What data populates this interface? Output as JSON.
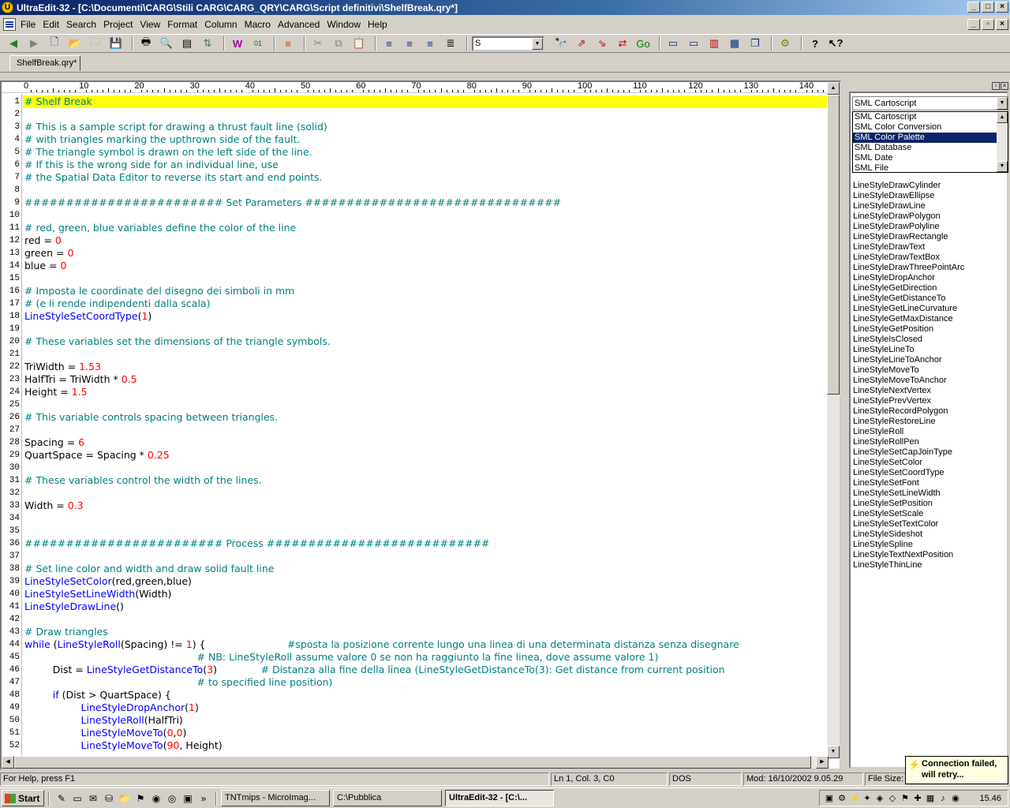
{
  "window": {
    "title": "UltraEdit-32 - [C:\\Documenti\\CARG\\Stili CARG\\CARG_QRY\\CARG\\Script definitivi\\ShelfBreak.qry*]"
  },
  "menu": [
    "File",
    "Edit",
    "Search",
    "Project",
    "View",
    "Format",
    "Column",
    "Macro",
    "Advanced",
    "Window",
    "Help"
  ],
  "toolbar": {
    "search_value": "S"
  },
  "tabs": [
    {
      "label": "ShelfBreak.qry*"
    }
  ],
  "ruler": [
    "0",
    "10",
    "20",
    "30",
    "40",
    "50",
    "60",
    "70",
    "80",
    "90",
    "100",
    "110",
    "120",
    "130",
    "140"
  ],
  "editor": {
    "lines": [
      {
        "n": "1",
        "hl": true,
        "segs": [
          [
            "c",
            "# Shelf Break"
          ]
        ]
      },
      {
        "n": "2",
        "segs": []
      },
      {
        "n": "3",
        "segs": [
          [
            "c",
            "# This is a sample script for drawing a thrust fault line (solid)"
          ]
        ]
      },
      {
        "n": "4",
        "segs": [
          [
            "c",
            "# with triangles marking the upthrown side of the fault."
          ]
        ]
      },
      {
        "n": "5",
        "segs": [
          [
            "c",
            "# The triangle symbol is drawn on the left side of the line."
          ]
        ]
      },
      {
        "n": "6",
        "segs": [
          [
            "c",
            "# If this is the wrong side for an individual line, use"
          ]
        ]
      },
      {
        "n": "7",
        "segs": [
          [
            "c",
            "# the Spatial Data Editor to reverse its start and end points."
          ]
        ]
      },
      {
        "n": "8",
        "segs": []
      },
      {
        "n": "9",
        "segs": [
          [
            "c",
            "######################## Set Parameters ###############################"
          ]
        ]
      },
      {
        "n": "10",
        "segs": []
      },
      {
        "n": "11",
        "segs": [
          [
            "c",
            "# red, green, blue variables define the color of the line"
          ]
        ]
      },
      {
        "n": "12",
        "segs": [
          [
            "t",
            "red = "
          ],
          [
            "n",
            "0"
          ]
        ]
      },
      {
        "n": "13",
        "segs": [
          [
            "t",
            "green = "
          ],
          [
            "n",
            "0"
          ]
        ]
      },
      {
        "n": "14",
        "segs": [
          [
            "t",
            "blue = "
          ],
          [
            "n",
            "0"
          ]
        ]
      },
      {
        "n": "15",
        "segs": []
      },
      {
        "n": "16",
        "segs": [
          [
            "c",
            "# Imposta le coordinate del disegno dei simboli in mm"
          ]
        ]
      },
      {
        "n": "17",
        "segs": [
          [
            "c",
            "# (e li rende indipendenti dalla scala)"
          ]
        ]
      },
      {
        "n": "18",
        "segs": [
          [
            "k",
            "LineStyleSetCoordType"
          ],
          [
            "t",
            "("
          ],
          [
            "n",
            "1"
          ],
          [
            "t",
            ")"
          ]
        ]
      },
      {
        "n": "19",
        "segs": []
      },
      {
        "n": "20",
        "segs": [
          [
            "c",
            "# These variables set the dimensions of the triangle symbols."
          ]
        ]
      },
      {
        "n": "21",
        "segs": []
      },
      {
        "n": "22",
        "segs": [
          [
            "t",
            "TriWidth = "
          ],
          [
            "n",
            "1.53"
          ]
        ]
      },
      {
        "n": "23",
        "segs": [
          [
            "t",
            "HalfTri = TriWidth * "
          ],
          [
            "n",
            "0.5"
          ]
        ]
      },
      {
        "n": "24",
        "segs": [
          [
            "t",
            "Height = "
          ],
          [
            "n",
            "1.5"
          ]
        ]
      },
      {
        "n": "25",
        "segs": []
      },
      {
        "n": "26",
        "segs": [
          [
            "c",
            "# This variable controls spacing between triangles."
          ]
        ]
      },
      {
        "n": "27",
        "segs": []
      },
      {
        "n": "28",
        "segs": [
          [
            "t",
            "Spacing = "
          ],
          [
            "n",
            "6"
          ]
        ]
      },
      {
        "n": "29",
        "segs": [
          [
            "t",
            "QuartSpace = Spacing * "
          ],
          [
            "n",
            "0.25"
          ]
        ]
      },
      {
        "n": "30",
        "segs": []
      },
      {
        "n": "31",
        "segs": [
          [
            "c",
            "# These variables control the width of the lines."
          ]
        ]
      },
      {
        "n": "32",
        "segs": []
      },
      {
        "n": "33",
        "segs": [
          [
            "t",
            "Width = "
          ],
          [
            "n",
            "0.3"
          ]
        ]
      },
      {
        "n": "34",
        "segs": []
      },
      {
        "n": "35",
        "segs": []
      },
      {
        "n": "36",
        "segs": [
          [
            "c",
            "######################## Process ###########################"
          ]
        ]
      },
      {
        "n": "37",
        "segs": []
      },
      {
        "n": "38",
        "segs": [
          [
            "c",
            "# Set line color and width and draw solid fault line"
          ]
        ]
      },
      {
        "n": "39",
        "segs": [
          [
            "k",
            "LineStyleSetColor"
          ],
          [
            "t",
            "(red,green,blue)"
          ]
        ]
      },
      {
        "n": "40",
        "segs": [
          [
            "k",
            "LineStyleSetLineWidth"
          ],
          [
            "t",
            "(Width)"
          ]
        ]
      },
      {
        "n": "41",
        "segs": [
          [
            "k",
            "LineStyleDrawLine"
          ],
          [
            "t",
            "()"
          ]
        ]
      },
      {
        "n": "42",
        "segs": []
      },
      {
        "n": "43",
        "segs": [
          [
            "c",
            "# Draw triangles"
          ]
        ]
      },
      {
        "n": "44",
        "segs": [
          [
            "k",
            "while"
          ],
          [
            "t",
            " ("
          ],
          [
            "k",
            "LineStyleRoll"
          ],
          [
            "t",
            "(Spacing) != "
          ],
          [
            "n",
            "1"
          ],
          [
            "t",
            ") {                          "
          ],
          [
            "c",
            "#sposta la posizione corrente lungo una linea di una determinata distanza senza disegnare"
          ]
        ]
      },
      {
        "n": "45",
        "segs": [
          [
            "t",
            "                                                       "
          ],
          [
            "c",
            "# NB: LineStyleRoll assume valore 0 se non ha raggiunto la fine linea, dove assume valore 1)"
          ]
        ]
      },
      {
        "n": "46",
        "segs": [
          [
            "t",
            "         Dist = "
          ],
          [
            "k",
            "LineStyleGetDistanceTo"
          ],
          [
            "t",
            "("
          ],
          [
            "n",
            "3"
          ],
          [
            "t",
            ")              "
          ],
          [
            "c",
            "# Distanza alla fine della linea (LineStyleGetDistanceTo(3): Get distance from current position"
          ]
        ]
      },
      {
        "n": "47",
        "segs": [
          [
            "t",
            "                                                       "
          ],
          [
            "c",
            "# to specified line position)"
          ]
        ]
      },
      {
        "n": "48",
        "segs": [
          [
            "t",
            "         "
          ],
          [
            "k",
            "if"
          ],
          [
            "t",
            " (Dist > QuartSpace) {"
          ]
        ]
      },
      {
        "n": "49",
        "segs": [
          [
            "t",
            "                  "
          ],
          [
            "k",
            "LineStyleDropAnchor"
          ],
          [
            "t",
            "("
          ],
          [
            "n",
            "1"
          ],
          [
            "t",
            ")"
          ]
        ]
      },
      {
        "n": "50",
        "segs": [
          [
            "t",
            "                  "
          ],
          [
            "k",
            "LineStyleRoll"
          ],
          [
            "t",
            "(HalfTri)"
          ]
        ]
      },
      {
        "n": "51",
        "segs": [
          [
            "t",
            "                  "
          ],
          [
            "k",
            "LineStyleMoveTo"
          ],
          [
            "t",
            "("
          ],
          [
            "n",
            "0"
          ],
          [
            "t",
            ","
          ],
          [
            "n",
            "0"
          ],
          [
            "t",
            ")"
          ]
        ]
      },
      {
        "n": "52",
        "segs": [
          [
            "t",
            "                  "
          ],
          [
            "k",
            "LineStyleMoveTo"
          ],
          [
            "t",
            "("
          ],
          [
            "n",
            "90"
          ],
          [
            "t",
            ", Height)"
          ]
        ]
      }
    ]
  },
  "panel": {
    "selected": "SML Cartoscript",
    "dropdown": [
      "SML Cartoscript",
      "SML Color Conversion",
      "SML Color Palette",
      "SML Database",
      "SML Date",
      "SML File"
    ],
    "dropdown_selected_index": 2,
    "functions": [
      "LineStyleDrawCylinder",
      "LineStyleDrawEllipse",
      "LineStyleDrawLine",
      "LineStyleDrawPolygon",
      "LineStyleDrawPolyline",
      "LineStyleDrawRectangle",
      "LineStyleDrawText",
      "LineStyleDrawTextBox",
      "LineStyleDrawThreePointArc",
      "LineStyleDropAnchor",
      "LineStyleGetDirection",
      "LineStyleGetDistanceTo",
      "LineStyleGetLineCurvature",
      "LineStyleGetMaxDistance",
      "LineStyleGetPosition",
      "LineStyleIsClosed",
      "LineStyleLineTo",
      "LineStyleLineToAnchor",
      "LineStyleMoveTo",
      "LineStyleMoveToAnchor",
      "LineStyleNextVertex",
      "LineStylePrevVertex",
      "LineStyleRecordPolygon",
      "LineStyleRestoreLine",
      "LineStyleRoll",
      "LineStyleRollPen",
      "LineStyleSetCapJoinType",
      "LineStyleSetColor",
      "LineStyleSetCoordType",
      "LineStyleSetFont",
      "LineStyleSetLineWidth",
      "LineStyleSetPosition",
      "LineStyleSetScale",
      "LineStyleSetTextColor",
      "LineStyleSideshot",
      "LineStyleSpline",
      "LineStyleTextNextPosition",
      "LineStyleThinLine"
    ]
  },
  "status": {
    "help": "For Help, press F1",
    "pos": "Ln 1, Col. 3, C0",
    "mode": "DOS",
    "modified": "Mod: 16/10/2002 9.05.29",
    "filesize": "File Size:"
  },
  "tooltip": {
    "text": "Connection failed, will retry..."
  },
  "taskbar": {
    "start": "Start",
    "tasks": [
      "TNTmips - MicroImag...",
      "C:\\Pubblica",
      "UltraEdit-32 - [C:\\..."
    ],
    "clock": "15.46"
  }
}
